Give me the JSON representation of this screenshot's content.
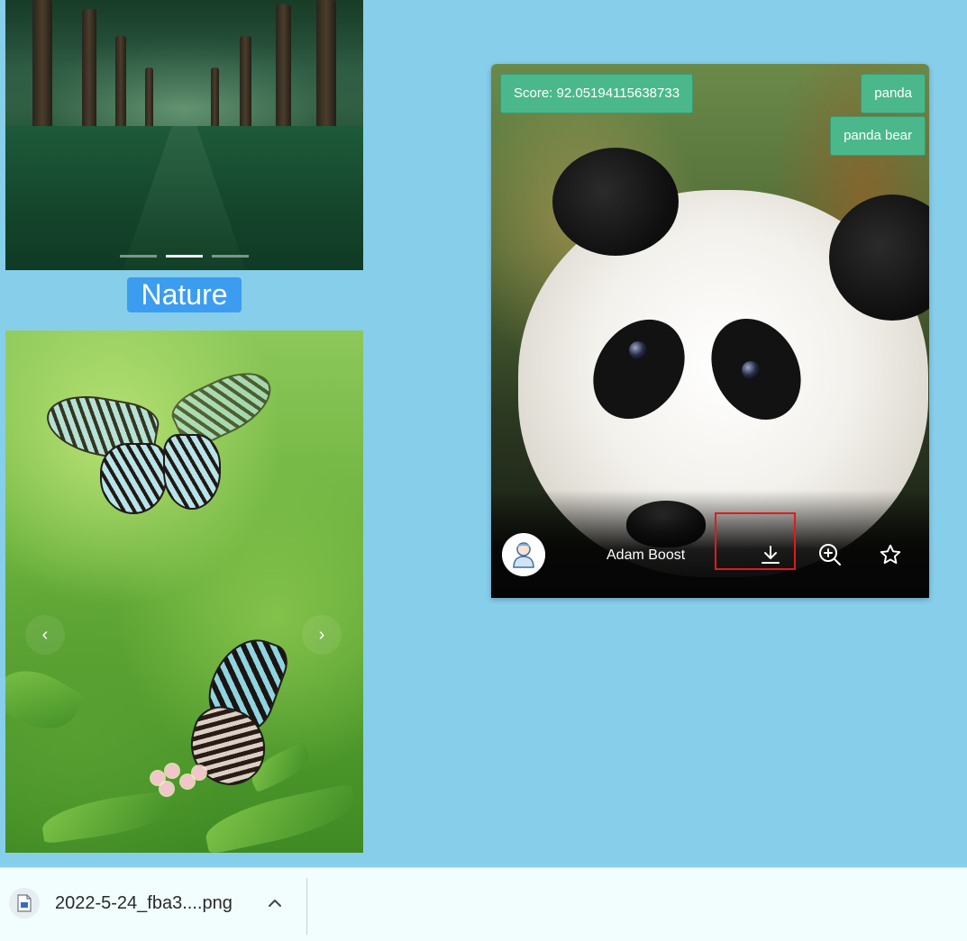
{
  "gallery": {
    "nature_carousel": {
      "indicators": [
        {
          "active": false
        },
        {
          "active": true
        },
        {
          "active": false
        }
      ]
    },
    "nature_label": "Nature",
    "butterfly_carousel": {
      "prev_icon": "chevron-left-icon",
      "next_icon": "chevron-right-icon",
      "prev_glyph": "‹",
      "next_glyph": "›"
    }
  },
  "image_card": {
    "score_label": "Score: 92.05194115638733",
    "tags": [
      "panda",
      "panda bear"
    ],
    "author": "Adam Boost",
    "actions": {
      "download_icon": "download-icon",
      "zoom_icon": "zoom-in-icon",
      "favorite_icon": "star-icon"
    },
    "highlight_color": "#e01b1b"
  },
  "download_bar": {
    "file_name": "2022-5-24_fba3....png",
    "file_icon": "image-file-icon",
    "expand_icon": "chevron-up-icon"
  },
  "colors": {
    "page_background": "#87ceeb",
    "tag_background": "#4bb88c",
    "nature_label_background": "#3c9cf0",
    "download_bar_background": "#f2fdfd"
  }
}
